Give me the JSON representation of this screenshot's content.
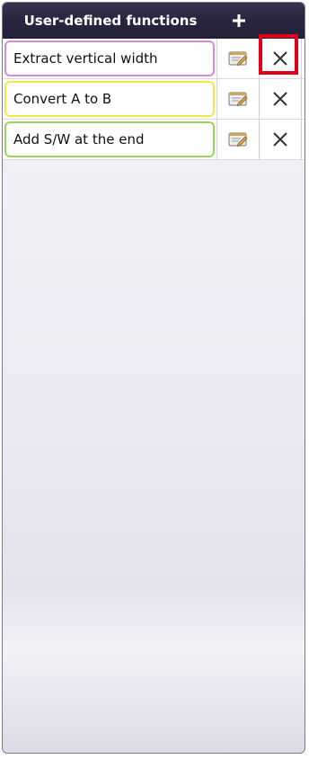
{
  "header": {
    "title": "User-defined functions",
    "add_icon": "plus-icon"
  },
  "functions": [
    {
      "name": "Extract vertical width",
      "border_color": "#d98ad9",
      "edit_icon": "edit-notepad-icon",
      "delete_icon": "close-icon"
    },
    {
      "name": "Convert A to B",
      "border_color": "#f0e84a",
      "edit_icon": "edit-notepad-icon",
      "delete_icon": "close-icon"
    },
    {
      "name": "Add S/W at the end",
      "border_color": "#9ad45a",
      "edit_icon": "edit-notepad-icon",
      "delete_icon": "close-icon"
    }
  ],
  "highlight": {
    "target": "delete-button of first row",
    "color": "#e0001b"
  }
}
